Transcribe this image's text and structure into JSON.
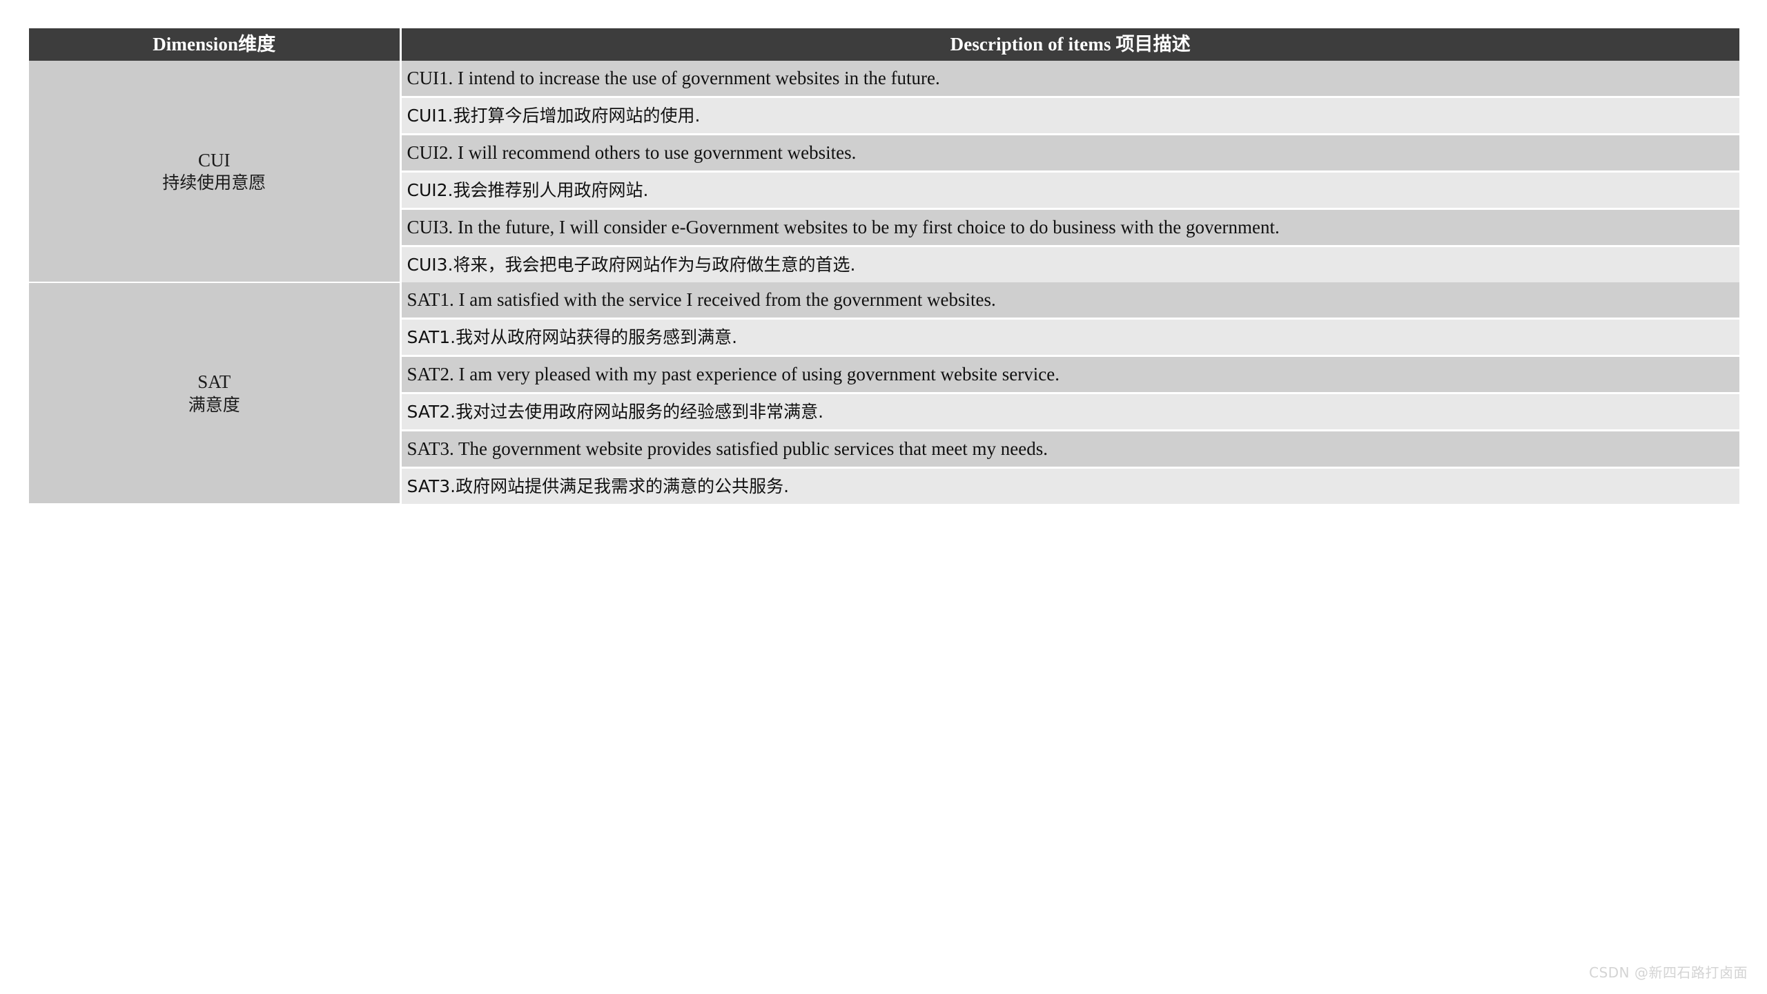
{
  "table": {
    "headers": {
      "dimension": "Dimension维度",
      "description": "Description of items 项目描述"
    },
    "colors": {
      "header_bg": "#3d3d3d",
      "header_fg": "#ffffff",
      "dimension_bg": "#cbcbcb",
      "row_dark_bg": "#cfcfcf",
      "row_light_bg": "#e8e8e8",
      "page_bg": "#ffffff",
      "text": "#111111"
    },
    "groups": [
      {
        "code": "CUI",
        "label_cn": "持续使用意愿",
        "items": [
          {
            "lang": "en",
            "text": "CUI1. I intend to increase the use of government websites in the future."
          },
          {
            "lang": "zh",
            "text": "CUI1.我打算今后增加政府网站的使用."
          },
          {
            "lang": "en",
            "text": "CUI2. I will recommend others to use government websites."
          },
          {
            "lang": "zh",
            "text": "CUI2.我会推荐别人用政府网站."
          },
          {
            "lang": "en",
            "text": "CUI3. In the future, I will consider e-Government websites to be my first choice to do business with the government."
          },
          {
            "lang": "zh",
            "text": "CUI3.将来，我会把电子政府网站作为与政府做生意的首选."
          }
        ]
      },
      {
        "code": "SAT",
        "label_cn": "满意度",
        "items": [
          {
            "lang": "en",
            "text": "SAT1. I am satisfied with the service I received from the government websites."
          },
          {
            "lang": "zh",
            "text": "SAT1.我对从政府网站获得的服务感到满意."
          },
          {
            "lang": "en",
            "text": "SAT2. I am very pleased with my past experience of using government website service."
          },
          {
            "lang": "zh",
            "text": "SAT2.我对过去使用政府网站服务的经验感到非常满意."
          },
          {
            "lang": "en",
            "text": "SAT3. The government website provides satisfied public services that meet my needs."
          },
          {
            "lang": "zh",
            "text": "SAT3.政府网站提供满足我需求的满意的公共服务."
          }
        ]
      }
    ]
  },
  "watermark": {
    "text": "CSDN @新四石路打卤面"
  }
}
